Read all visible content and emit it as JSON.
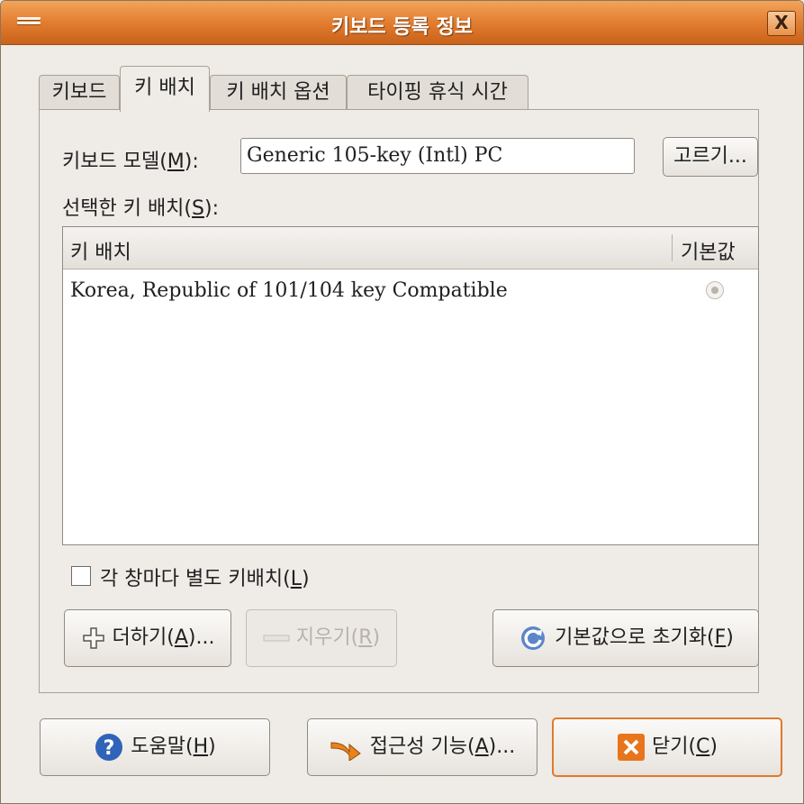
{
  "window": {
    "title": "키보드 등록 정보",
    "close_glyph": "X"
  },
  "tabs": [
    {
      "label": "키보드",
      "active": false
    },
    {
      "label": "키 배치",
      "active": true
    },
    {
      "label": "키 배치 옵션",
      "active": false
    },
    {
      "label": "타이핑 휴식 시간",
      "active": false
    }
  ],
  "keyboard_model": {
    "label_pre": "키보드 모델(",
    "mnemonic": "M",
    "label_post": "):",
    "value": "Generic 105-key (Intl) PC",
    "choose_label": "고르기..."
  },
  "selected_layouts": {
    "label_pre": "선택한 키 배치(",
    "mnemonic": "S",
    "label_post": "):"
  },
  "layout_list": {
    "columns": [
      "키 배치",
      "기본값"
    ],
    "rows": [
      {
        "name": "Korea, Republic of 101/104 key Compatible",
        "default": true
      }
    ]
  },
  "separate_layout": {
    "label_pre": "각 창마다 별도 키배치(",
    "mnemonic": "L",
    "label_post": ")",
    "checked": false
  },
  "actions": {
    "add": {
      "pre": "더하기(",
      "mnemonic": "A",
      "post": ")..."
    },
    "remove": {
      "pre": "지우기(",
      "mnemonic": "R",
      "post": ")"
    },
    "reset": {
      "pre": "기본값으로 초기화(",
      "mnemonic": "F",
      "post": ")"
    }
  },
  "footer": {
    "help": {
      "pre": "도움말(",
      "mnemonic": "H",
      "post": ")"
    },
    "accessibility": {
      "pre": "접근성 기능(",
      "mnemonic": "A",
      "post": ")..."
    },
    "close": {
      "pre": "닫기(",
      "mnemonic": "C",
      "post": ")"
    }
  },
  "colors": {
    "titlebar": "#e07a2c",
    "focus": "#e07a2c",
    "help_icon": "#2f64b8",
    "close_icon": "#e8741c"
  },
  "icons": {
    "menu": "window-menu-icon",
    "add": "plus-icon",
    "remove": "minus-icon",
    "reset": "refresh-icon",
    "help": "help-icon",
    "accessibility": "accessibility-arrow-icon",
    "close": "close-x-icon"
  }
}
